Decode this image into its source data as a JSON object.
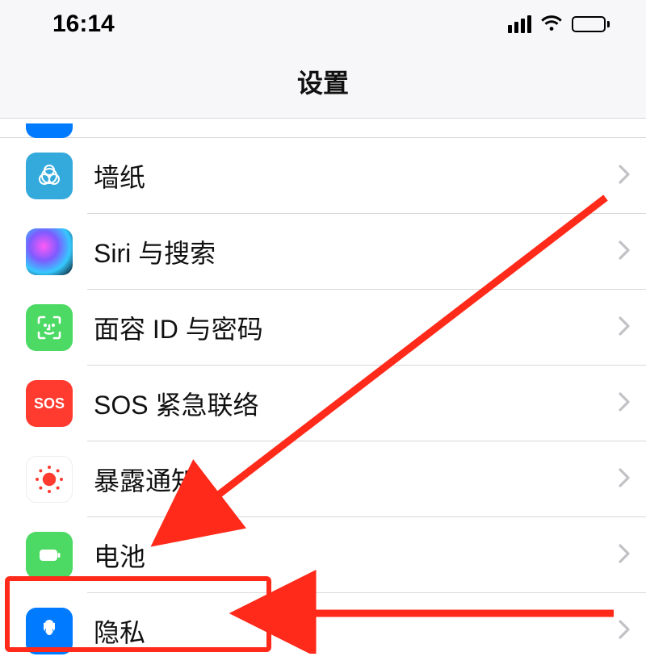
{
  "status": {
    "time": "16:14"
  },
  "header": {
    "title": "设置"
  },
  "rows": {
    "wallpaper": "墙纸",
    "siri": "Siri 与搜索",
    "faceid": "面容 ID 与密码",
    "sos": "SOS 紧急联络",
    "exposure": "暴露通知",
    "battery": "电池",
    "privacy": "隐私"
  },
  "icon_text": {
    "sos": "SOS"
  }
}
